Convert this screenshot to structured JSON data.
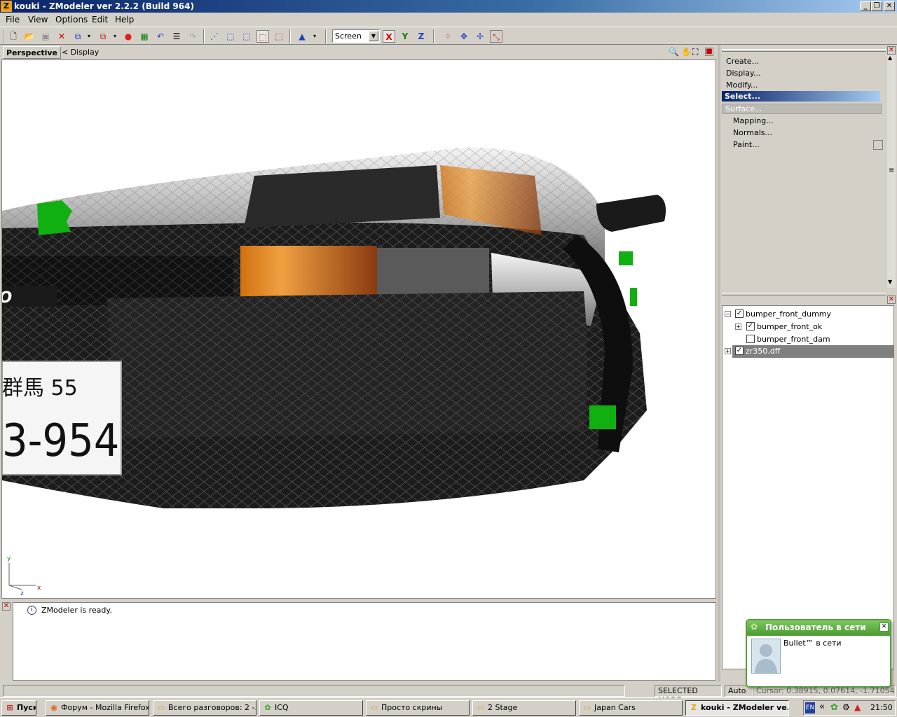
{
  "window": {
    "title": "kouki - ZModeler ver 2.2.2 (Build 964)",
    "app_icon": "Z",
    "minimize": "_",
    "maximize": "❐",
    "close": "✕"
  },
  "menu": [
    {
      "label": "File"
    },
    {
      "label": "View"
    },
    {
      "label": "Options"
    },
    {
      "label": "Edit"
    },
    {
      "label": "Help"
    }
  ],
  "toolbar": {
    "space_select": "Screen",
    "axis_x": "X",
    "axis_y": "Y",
    "axis_z": "Z"
  },
  "viewport": {
    "name": "Perspective",
    "display_label": "<  Display",
    "axis_y": "y",
    "axis_x": "x",
    "axis_z": "z",
    "plate_top": "群馬 55",
    "plate_bottom": "3-954",
    "badge": "UENO"
  },
  "command_panel": {
    "items": [
      {
        "label": "Create..."
      },
      {
        "label": "Display..."
      },
      {
        "label": "Modify..."
      }
    ],
    "selected": "Select...",
    "disabled": "Surface...",
    "subitems": [
      {
        "label": "Mapping..."
      },
      {
        "label": "Normals..."
      },
      {
        "label": "Paint..."
      }
    ]
  },
  "tree": {
    "rows": [
      {
        "label": "bumper_front_dummy",
        "checked": true
      },
      {
        "label": "bumper_front_ok",
        "checked": true
      },
      {
        "label": "bumper_front_dam",
        "checked": false
      },
      {
        "label": "zr350.dff",
        "checked": true
      }
    ]
  },
  "log": {
    "message": "ZModeler is ready."
  },
  "status": {
    "mode": "SELECTED MODE",
    "auto": "Auto",
    "cursor": "Cursor: 0.38915, 0.07614, -1.71054"
  },
  "taskbar": {
    "start": "Пуск",
    "tasks": [
      {
        "label": "Форум - Mozilla Firefox"
      },
      {
        "label": "Всего разговоров: 2 -..."
      },
      {
        "label": "ICQ"
      },
      {
        "label": "Просто скрины"
      },
      {
        "label": "2 Stage"
      },
      {
        "label": "Japan Cars"
      },
      {
        "label": "kouki - ZModeler ve..."
      }
    ],
    "lang": "EN",
    "time": "21:50"
  },
  "icq_popup": {
    "title": "Пользователь в сети",
    "message": "Bullet™ в сети"
  },
  "colors": {
    "titlebar": "#0a246a",
    "selection": "#0a246a",
    "helper_green": "#10b010"
  }
}
